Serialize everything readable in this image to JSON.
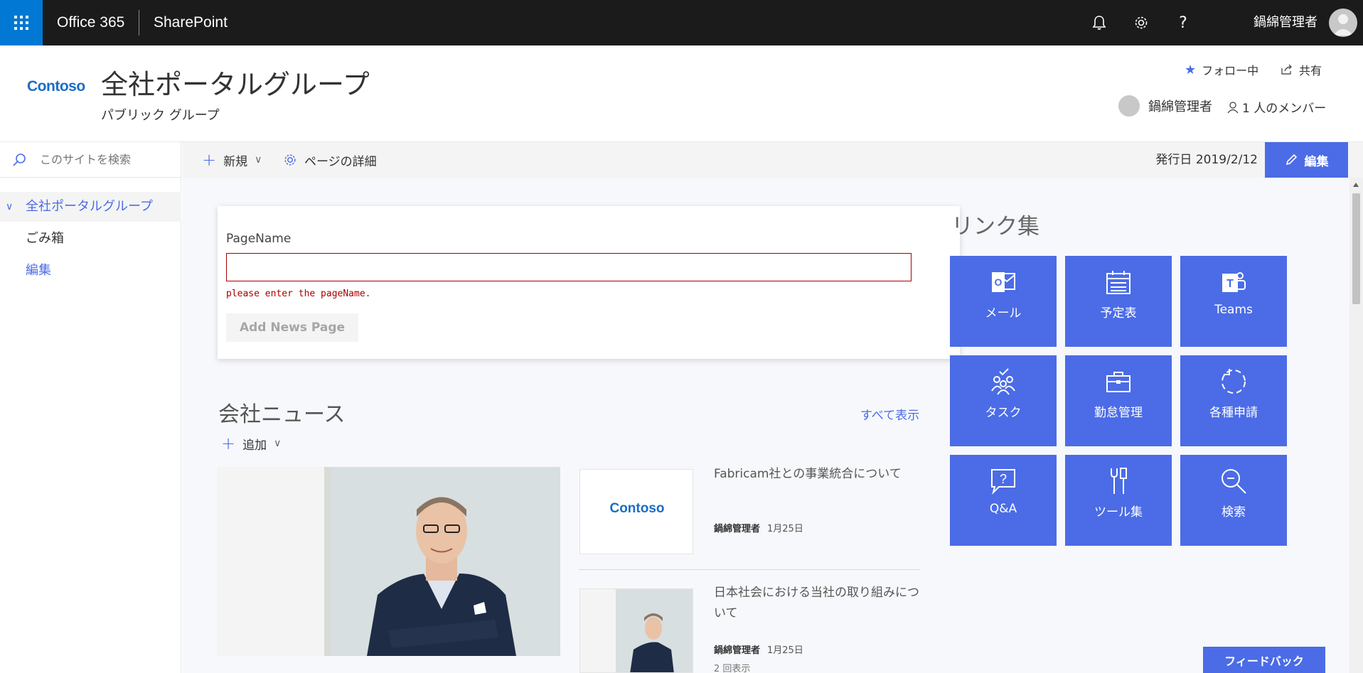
{
  "suite": {
    "app_launcher_icon": "waffle-icon",
    "title": "Office 365",
    "app": "SharePoint",
    "user": "鍋綿管理者",
    "icons": [
      "bell-icon",
      "gear-icon",
      "help-icon"
    ],
    "help_glyph": "?"
  },
  "site": {
    "logo": "Contoso",
    "title": "全社ポータルグループ",
    "subtitle": "パブリック グループ",
    "follow": "フォロー中",
    "share": "共有",
    "owner": "鍋綿管理者",
    "members": "1 人のメンバー"
  },
  "nav": {
    "search_placeholder": "このサイトを検索",
    "items": [
      {
        "label": "全社ポータルグループ"
      },
      {
        "label": "ごみ箱"
      },
      {
        "label": "編集"
      }
    ]
  },
  "command": {
    "new": "新規",
    "details": "ページの詳細",
    "published": "発行日 2019/2/12",
    "edit": "編集"
  },
  "form": {
    "label": "PageName",
    "value": "",
    "error": "please enter the pageName.",
    "button": "Add News Page"
  },
  "news": {
    "title": "会社ニュース",
    "see_all": "すべて表示",
    "add": "追加",
    "items": [
      {
        "title": "Fabricam社との事業統合について",
        "author": "鍋綿管理者",
        "date": "1月25日",
        "thumb_text": "Contoso"
      },
      {
        "title": "日本社会における当社の取り組みについて",
        "author": "鍋綿管理者",
        "date": "1月25日",
        "views": "2 回表示"
      }
    ]
  },
  "links": {
    "title": "リンク集",
    "tiles": [
      {
        "label": "メール",
        "icon": "outlook-icon"
      },
      {
        "label": "予定表",
        "icon": "calendar-icon"
      },
      {
        "label": "Teams",
        "icon": "teams-icon"
      },
      {
        "label": "タスク",
        "icon": "tasks-icon"
      },
      {
        "label": "勤怠管理",
        "icon": "briefcase-icon"
      },
      {
        "label": "各種申請",
        "icon": "refresh-icon"
      },
      {
        "label": "Q&A",
        "icon": "question-icon"
      },
      {
        "label": "ツール集",
        "icon": "tools-icon"
      },
      {
        "label": "検索",
        "icon": "search-icon"
      }
    ]
  },
  "feedback": "フィードバック",
  "colors": {
    "accent": "#4b6ce6",
    "suitebar": "#1b1b1b",
    "waffle": "#0078d4",
    "error": "#a80000"
  }
}
